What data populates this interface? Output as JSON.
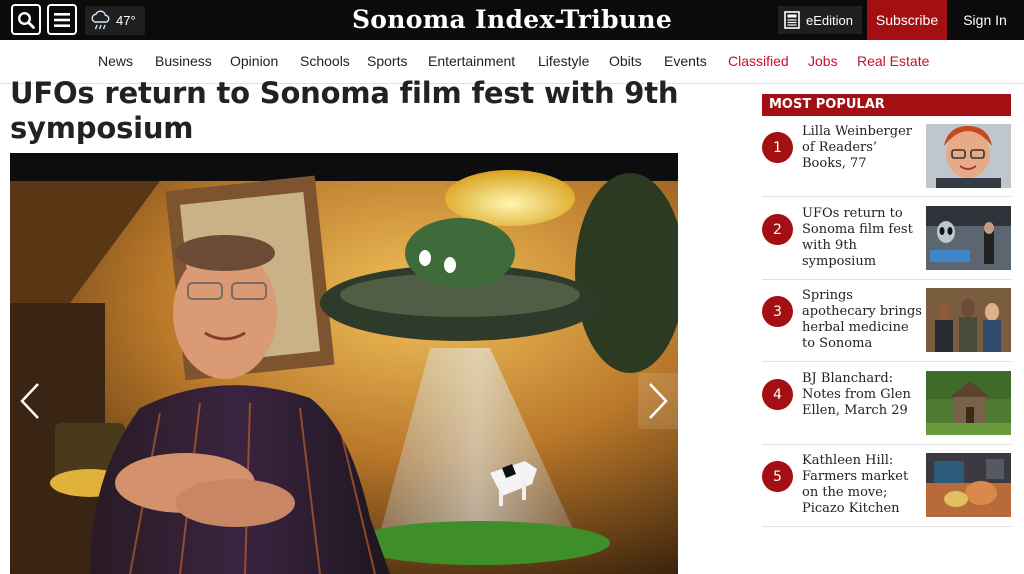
{
  "header": {
    "masthead": "Sonoma Index-Tribune",
    "weather": {
      "temperature": "47°",
      "icon": "rain-cloud-icon"
    },
    "edition_label": "eEdition",
    "subscribe_label": "Subscribe",
    "signin_label": "Sign In",
    "colors": {
      "bar": "#0b0b0b",
      "accent": "#a30f12"
    }
  },
  "nav": {
    "items": [
      {
        "label": "News"
      },
      {
        "label": "Business"
      },
      {
        "label": "Opinion"
      },
      {
        "label": "Schools"
      },
      {
        "label": "Sports"
      },
      {
        "label": "Entertainment"
      },
      {
        "label": "Lifestyle"
      },
      {
        "label": "Obits"
      },
      {
        "label": "Events"
      },
      {
        "label": "Classified"
      },
      {
        "label": "Jobs"
      },
      {
        "label": "Real Estate"
      }
    ]
  },
  "article": {
    "headline": "UFOs return to Sonoma film fest with 9th symposium"
  },
  "sidebar": {
    "heading": "MOST POPULAR",
    "items": [
      {
        "num": "1",
        "title": "Lilla Weinberger of Readers’ Books, 77"
      },
      {
        "num": "2",
        "title": "UFOs return to Sonoma film fest with 9th symposium"
      },
      {
        "num": "3",
        "title": "Springs apothecary brings herbal medicine to Sonoma"
      },
      {
        "num": "4",
        "title": "BJ Blanchard: Notes from Glen Ellen, March 29"
      },
      {
        "num": "5",
        "title": "Kathleen Hill: Farmers market on the move; Picazo Kitchen"
      }
    ]
  }
}
